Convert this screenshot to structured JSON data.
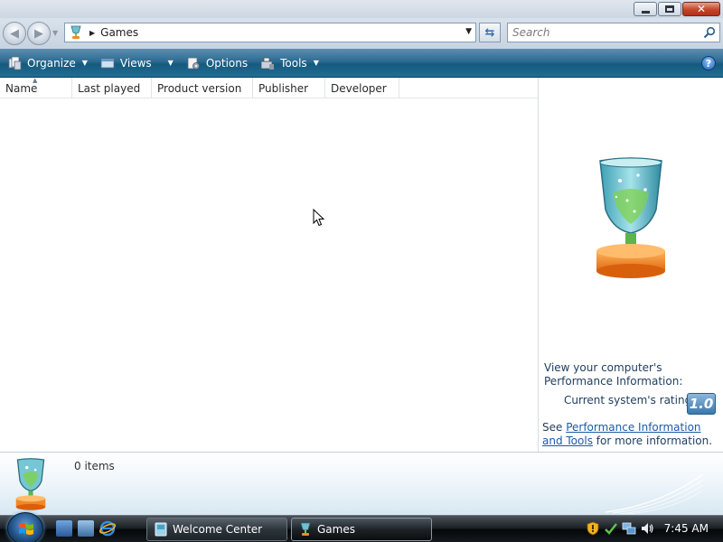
{
  "window": {
    "controls": {
      "minimize": "minimize",
      "maximize": "maximize",
      "close": "close"
    }
  },
  "address": {
    "location": "Games",
    "search_placeholder": "Search"
  },
  "toolbar": {
    "items": [
      {
        "label": "Organize",
        "icon": "organize-icon",
        "has_dropdown": true
      },
      {
        "label": "Views",
        "icon": "views-icon",
        "has_dropdown": true
      },
      {
        "label": "Options",
        "icon": "options-icon",
        "has_dropdown": false
      },
      {
        "label": "Tools",
        "icon": "tools-icon",
        "has_dropdown": true
      }
    ],
    "help_label": "?"
  },
  "columns": [
    "Name",
    "Last played",
    "Product version",
    "Publisher",
    "Developer"
  ],
  "sorted_column": "Name",
  "preview": {
    "performance_title": "View your computer's Performance Information:",
    "rating_label": "Current system's rating:",
    "rating_value": "1.0",
    "note_prefix": "See ",
    "note_link": "Performance Information and Tools",
    "note_suffix": " for more information."
  },
  "details": {
    "item_count": "0 items"
  },
  "taskbar": {
    "buttons": [
      {
        "label": "Welcome Center",
        "icon": "welcome-center-icon"
      },
      {
        "label": "Games",
        "icon": "games-icon"
      }
    ],
    "clock": "7:45 AM"
  },
  "colors": {
    "command_bar": "#1f6e92",
    "link": "#1a5aa6",
    "rating_badge": "#3a78ad",
    "close_button": "#c4442a"
  }
}
